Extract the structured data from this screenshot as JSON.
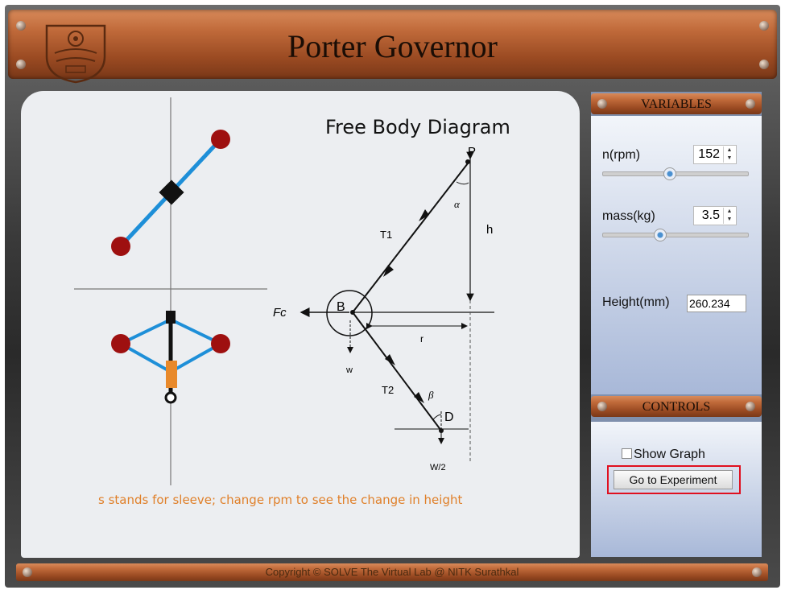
{
  "header": {
    "title": "Porter Governor"
  },
  "diagram": {
    "title": "Free Body Diagram",
    "labels": {
      "P": "P",
      "alpha": "α",
      "T1": "T1",
      "h": "h",
      "Fc": "Fc",
      "B": "B",
      "r": "r",
      "w": "w",
      "T2": "T2",
      "beta": "β",
      "D": "D",
      "W2": "W/2"
    },
    "note": "s stands for sleeve; change rpm to see the change in height"
  },
  "variables": {
    "title": "VARIABLES",
    "rpm": {
      "label": "n(rpm)",
      "value": "152",
      "slider_fraction": 0.45
    },
    "mass": {
      "label": "mass(kg)",
      "value": "3.5",
      "slider_fraction": 0.38
    },
    "height": {
      "label": "Height(mm)",
      "value": "260.234"
    }
  },
  "controls": {
    "title": "CONTROLS",
    "show_graph": {
      "label": "Show Graph",
      "checked": false
    },
    "go_button": "Go to Experiment"
  },
  "footer": {
    "text": "Copyright © SOLVE The Virtual Lab @ NITK Surathkal"
  },
  "colors": {
    "wood": "#a8552a",
    "ball": "#9e1010",
    "arm": "#1e8fd8",
    "sleeve": "#e8892a",
    "note": "#e0802a",
    "highlight": "#e01020"
  }
}
